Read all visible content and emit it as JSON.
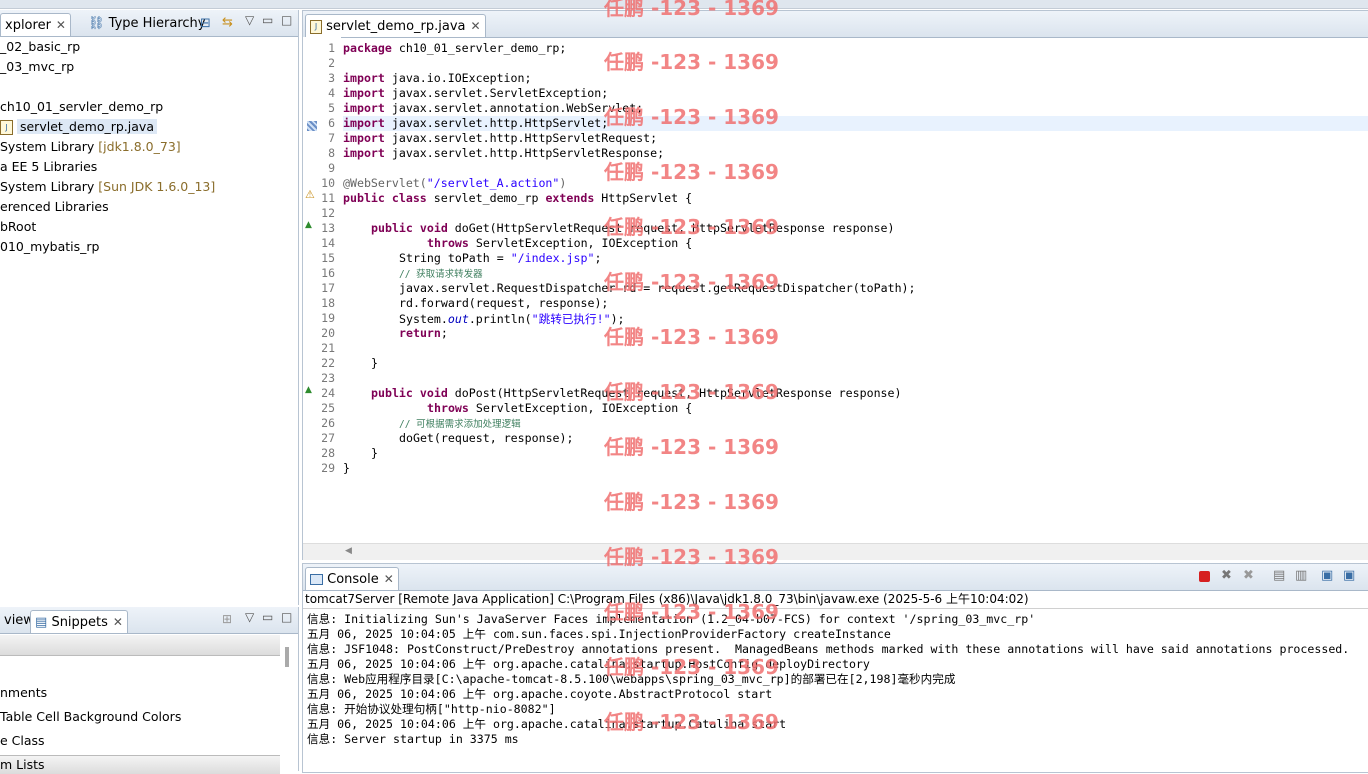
{
  "left_top": {
    "tabs": [
      {
        "label": "xplorer"
      },
      {
        "label": "Type Hierarchy"
      }
    ],
    "tree": [
      {
        "label": "_02_basic_rp"
      },
      {
        "label": "_03_mvc_rp"
      },
      {
        "label": "ch10_01_servler_demo_rp"
      },
      {
        "label": "servlet_demo_rp.java"
      },
      {
        "label": " System Library ",
        "extra": "[jdk1.8.0_73]"
      },
      {
        "label": "a EE 5 Libraries"
      },
      {
        "label": " System Library ",
        "extra": "[Sun JDK 1.6.0_13]"
      },
      {
        "label": "erenced Libraries"
      },
      {
        "label": "bRoot"
      },
      {
        "label": "010_mybatis_rp"
      }
    ]
  },
  "left_bottom": {
    "tabs": [
      {
        "label": "view"
      },
      {
        "label": "Snippets"
      }
    ],
    "items": [
      {
        "label": "nments"
      },
      {
        "label": " Table Cell Background Colors"
      },
      {
        "label": "e Class"
      },
      {
        "label": "m Lists"
      }
    ]
  },
  "editor": {
    "tab_label": "servlet_demo_rp.java",
    "lines": [
      {
        "n": "1"
      },
      {
        "n": "2"
      },
      {
        "n": "3"
      },
      {
        "n": "4"
      },
      {
        "n": "5"
      },
      {
        "n": "6"
      },
      {
        "n": "7"
      },
      {
        "n": "8"
      },
      {
        "n": "9"
      },
      {
        "n": "10"
      },
      {
        "n": "11"
      },
      {
        "n": "12"
      },
      {
        "n": "13"
      },
      {
        "n": "14"
      },
      {
        "n": "15"
      },
      {
        "n": "16"
      },
      {
        "n": "17"
      },
      {
        "n": "18"
      },
      {
        "n": "19"
      },
      {
        "n": "20"
      },
      {
        "n": "21"
      },
      {
        "n": "22"
      },
      {
        "n": "23"
      },
      {
        "n": "24"
      },
      {
        "n": "25"
      },
      {
        "n": "26"
      },
      {
        "n": "27"
      },
      {
        "n": "28"
      },
      {
        "n": "29"
      }
    ],
    "code": {
      "l1_kw": "package",
      "l1": " ch10_01_servler_demo_rp;",
      "l3_kw": "import",
      "l3": " java.io.IOException;",
      "l4_kw": "import",
      "l4": " javax.servlet.ServletException;",
      "l5_kw": "import",
      "l5": " javax.servlet.annotation.WebServlet;",
      "l6_kw": "import",
      "l6": " javax.servlet.http.HttpServlet;",
      "l7_kw": "import",
      "l7": " javax.servlet.http.HttpServletRequest;",
      "l8_kw": "import",
      "l8": " javax.servlet.http.HttpServletResponse;",
      "l10_ann": "@WebServlet(",
      "l10_str": "\"/servlet_A.action\"",
      "l10_end": ")",
      "l11_kw1": "public",
      "l11_kw2": "class",
      "l11_name": " servlet_demo_rp ",
      "l11_kw3": "extends",
      "l11_end": " HttpServlet {",
      "l13_kw1": "public",
      "l13_kw2": "void",
      "l13": " doGet(HttpServletRequest request, HttpServletResponse response)",
      "l14_kw": "throws",
      "l14": " ServletException, IOException {",
      "l15": "String toPath = ",
      "l15_str": "\"/index.jsp\"",
      "l15_end": ";",
      "l16_cm": "// 获取请求转发器",
      "l17": "javax.servlet.RequestDispatcher rd = request.getRequestDispatcher(toPath);",
      "l18": "rd.forward(request, response);",
      "l19": "System.",
      "l19_fld": "out",
      "l19_mid": ".println(",
      "l19_str": "\"跳转已执行!\"",
      "l19_end": ");",
      "l20_kw": "return",
      "l20": ";",
      "l22": "}",
      "l24_kw1": "public",
      "l24_kw2": "void",
      "l24": " doPost(HttpServletRequest request, HttpServletResponse response)",
      "l25_kw": "throws",
      "l25": " ServletException, IOException {",
      "l26_cm": "// 可根据需求添加处理逻辑",
      "l27": "doGet(request, response);",
      "l28": "}",
      "l29": "}"
    }
  },
  "console": {
    "tab_label": "Console",
    "header": "tomcat7Server [Remote Java Application] C:\\Program Files (x86)\\Java\\jdk1.8.0_73\\bin\\javaw.exe (2025-5-6 上午10:04:02)",
    "lines": [
      "信息: Initializing Sun's JavaServer Faces implementation (1.2_04-b07-FCS) for context '/spring_03_mvc_rp'",
      "五月 06, 2025 10:04:05 上午 com.sun.faces.spi.InjectionProviderFactory createInstance",
      "信息: JSF1048: PostConstruct/PreDestroy annotations present.  ManagedBeans methods marked with these annotations will have said annotations processed.",
      "五月 06, 2025 10:04:06 上午 org.apache.catalina.startup.HostConfig deployDirectory",
      "信息: Web应用程序目录[C:\\apache-tomcat-8.5.100\\webapps\\spring_03_mvc_rp]的部署已在[2,198]毫秒内完成",
      "五月 06, 2025 10:04:06 上午 org.apache.coyote.AbstractProtocol start",
      "信息: 开始协议处理句柄[\"http-nio-8082\"]",
      "五月 06, 2025 10:04:06 上午 org.apache.catalina.startup.Catalina start",
      "信息: Server startup in 3375 ms"
    ]
  },
  "watermark": "任鹏 -123 - 1369",
  "colors": {
    "keyword": "#7f0055",
    "string": "#2a00ff",
    "comment": "#3f7f5f",
    "watermark": "#f07070"
  }
}
